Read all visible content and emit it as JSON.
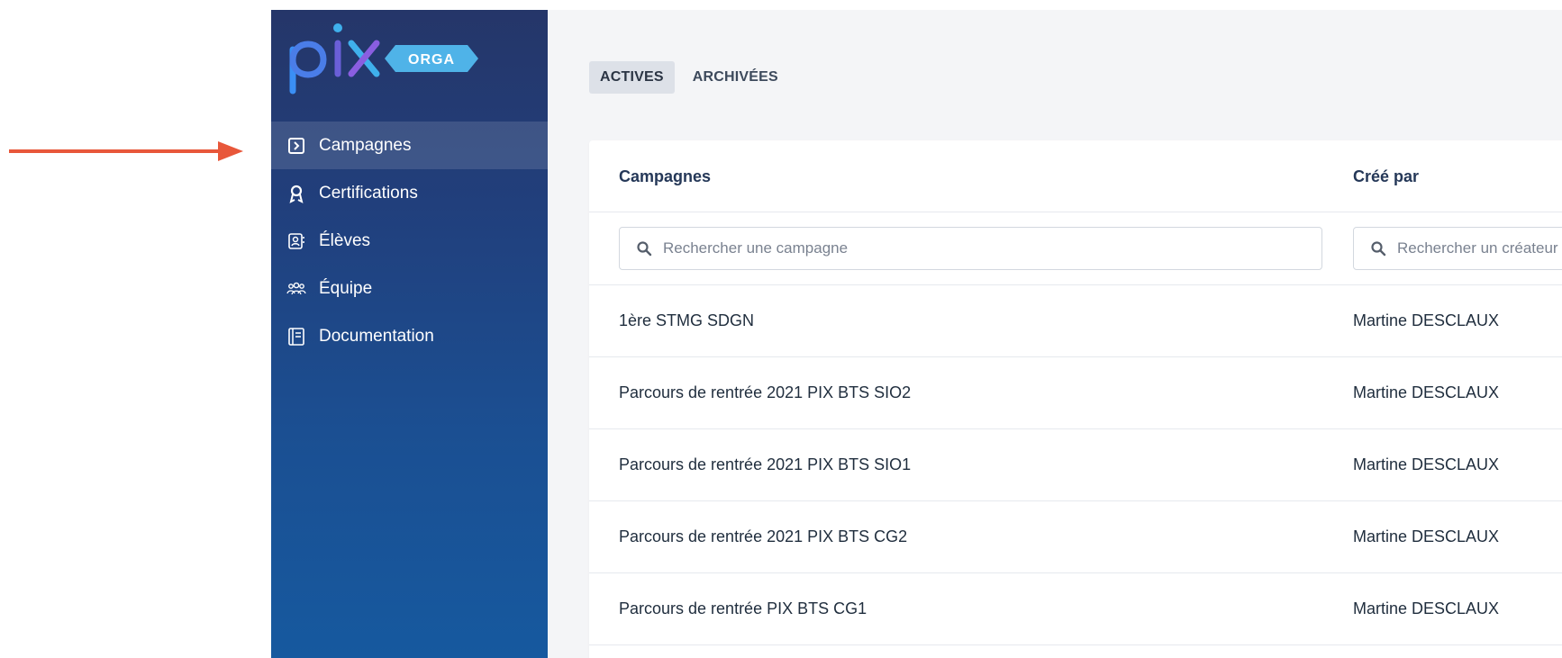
{
  "app": {
    "logo_text": "pix",
    "logo_badge": "ORGA"
  },
  "sidebar": {
    "items": [
      {
        "label": "Campagnes",
        "icon": "campaign-icon",
        "active": true
      },
      {
        "label": "Certifications",
        "icon": "certification-icon",
        "active": false
      },
      {
        "label": "Élèves",
        "icon": "students-icon",
        "active": false
      },
      {
        "label": "Équipe",
        "icon": "team-icon",
        "active": false
      },
      {
        "label": "Documentation",
        "icon": "documentation-icon",
        "active": false
      }
    ]
  },
  "tabs": [
    {
      "label": "ACTIVES",
      "active": true
    },
    {
      "label": "ARCHIVÉES",
      "active": false
    }
  ],
  "table": {
    "columns": [
      "Campagnes",
      "Créé par"
    ],
    "filters": {
      "campaign_placeholder": "Rechercher une campagne",
      "creator_placeholder": "Rechercher un créateur"
    },
    "rows": [
      {
        "name": "1ère STMG SDGN",
        "creator": "Martine DESCLAUX"
      },
      {
        "name": "Parcours de rentrée 2021 PIX BTS SIO2",
        "creator": "Martine DESCLAUX"
      },
      {
        "name": "Parcours de rentrée 2021 PIX BTS SIO1",
        "creator": "Martine DESCLAUX"
      },
      {
        "name": "Parcours de rentrée 2021 PIX BTS CG2",
        "creator": "Martine DESCLAUX"
      },
      {
        "name": "Parcours de rentrée PIX BTS CG1",
        "creator": "Martine DESCLAUX"
      }
    ]
  },
  "colors": {
    "annotation_arrow": "#e8573a",
    "sidebar_top": "#253669",
    "sidebar_bottom": "#16599f",
    "logo_blue": "#3a8ff5",
    "logo_badge": "#4fb3e8"
  }
}
